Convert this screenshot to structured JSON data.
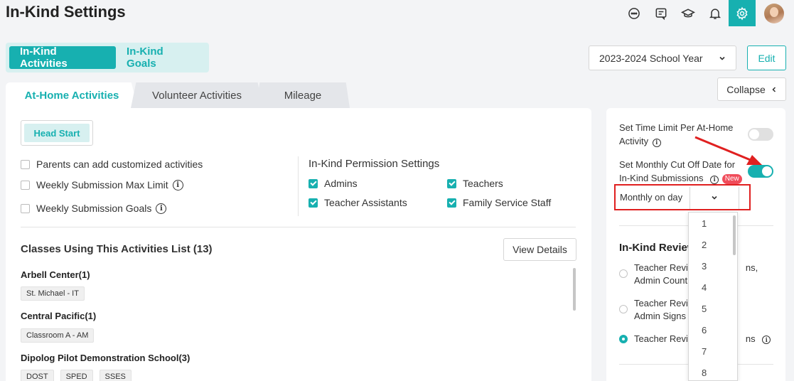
{
  "page": {
    "title": "In-Kind Settings"
  },
  "header_icons": [
    {
      "name": "chat-icon",
      "active": false
    },
    {
      "name": "receipt-icon",
      "active": false
    },
    {
      "name": "graduation-cap-icon",
      "active": false
    },
    {
      "name": "bell-icon",
      "active": false
    },
    {
      "name": "gear-icon",
      "active": true
    }
  ],
  "main_tabs": [
    {
      "label": "In-Kind Activities",
      "active": true
    },
    {
      "label": "In-Kind Goals",
      "active": false
    }
  ],
  "toolbar": {
    "year_select": "2023-2024 School Year",
    "edit_label": "Edit",
    "collapse_label": "Collapse"
  },
  "sub_tabs": [
    {
      "label": "At-Home Activities",
      "active": true
    },
    {
      "label": "Volunteer Activities",
      "active": false
    },
    {
      "label": "Mileage",
      "active": false
    }
  ],
  "program": {
    "label": "Head Start"
  },
  "options": [
    {
      "label": "Parents can add customized activities",
      "checked": false,
      "info": false
    },
    {
      "label": "Weekly Submission Max Limit",
      "checked": false,
      "info": true
    },
    {
      "label": "Weekly Submission Goals",
      "checked": false,
      "info": true
    }
  ],
  "permissions": {
    "title": "In-Kind Permission Settings",
    "items": [
      {
        "label": "Admins",
        "checked": true
      },
      {
        "label": "Teachers",
        "checked": true
      },
      {
        "label": "Teacher Assistants",
        "checked": true
      },
      {
        "label": "Family Service Staff",
        "checked": true
      }
    ]
  },
  "classes": {
    "title": "Classes Using This Activities List (13)",
    "view_details_label": "View Details",
    "centers": [
      {
        "name": "Arbell Center(1)",
        "tags": [
          "St. Michael - IT"
        ]
      },
      {
        "name": "Central Pacific(1)",
        "tags": [
          "Classroom A - AM"
        ]
      },
      {
        "name": "Dipolog Pilot Demonstration School(3)",
        "tags": [
          "DOST",
          "SPED",
          "SSES"
        ]
      }
    ]
  },
  "side": {
    "time_limit_label": "Set Time Limit Per At-Home Activity",
    "time_limit_on": false,
    "cutoff_label_1": "Set Monthly Cut Off Date for",
    "cutoff_label_2": "In-Kind Submissions",
    "cutoff_on": true,
    "new_badge": "New",
    "monthly_label": "Monthly on day",
    "review_title": "In-Kind Review",
    "review_options": [
      {
        "line1": "Teacher Revi",
        "line1_end": "ns,",
        "line2": "Admin Count",
        "selected": false
      },
      {
        "line1": "Teacher Revi",
        "line1_end": "",
        "line2": "Admin Signs",
        "selected": false
      },
      {
        "line1": "Teacher Revi",
        "line1_end": "ns",
        "line2": "",
        "selected": true
      }
    ]
  },
  "day_options": [
    "1",
    "2",
    "3",
    "4",
    "5",
    "6",
    "7",
    "8"
  ],
  "colors": {
    "accent": "#17b0b0",
    "highlight": "#e02020",
    "badge": "#f04c5a"
  }
}
